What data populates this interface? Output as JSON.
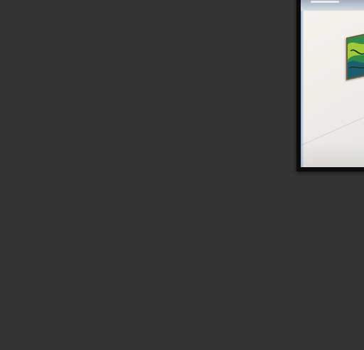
{
  "canvas": {
    "background_color": "#343434"
  },
  "preview": {
    "frame_color": "#0c0c0c",
    "subject": "gallery-wall-with-framed-painting",
    "painting_colors": [
      "#1e6a3a",
      "#3fa35a",
      "#b6d23a",
      "#1a4e7a"
    ]
  }
}
